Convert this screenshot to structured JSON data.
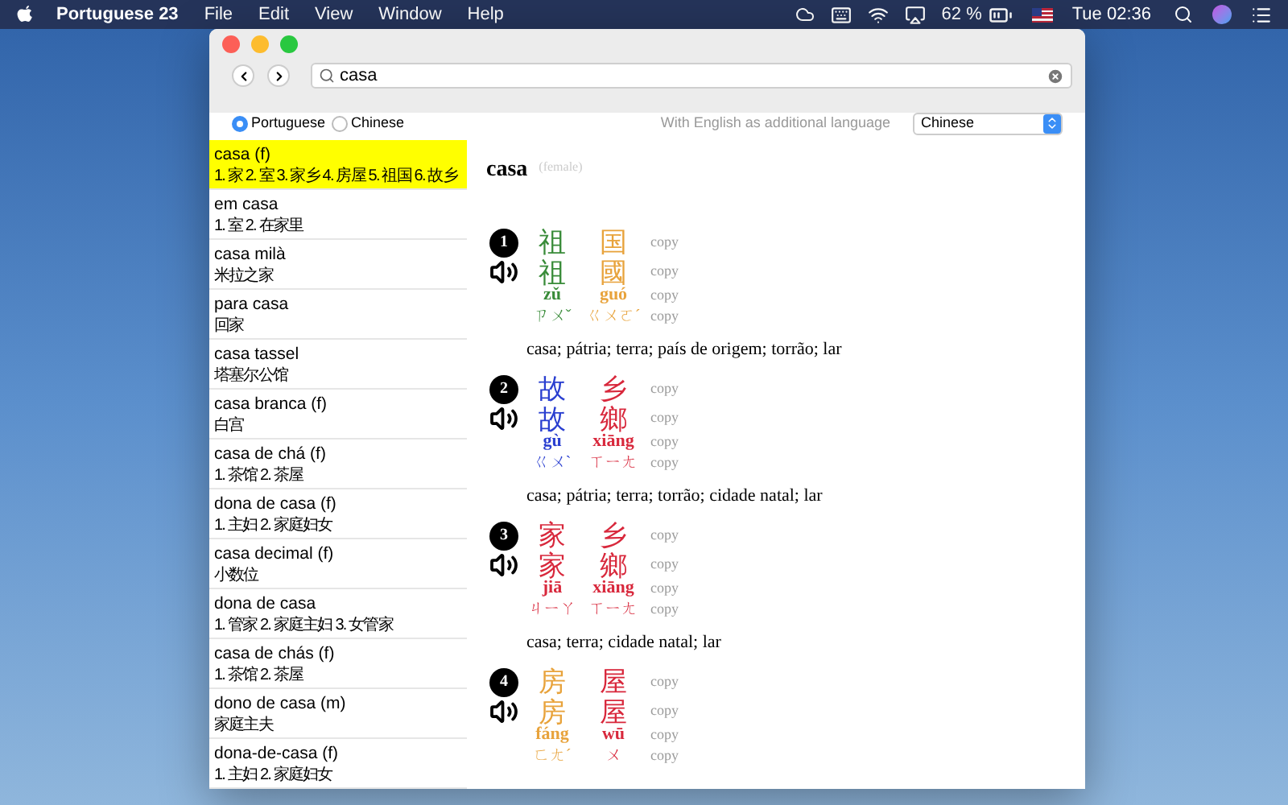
{
  "menu_bar": {
    "app_name": "Portuguese 23",
    "menus": [
      "File",
      "Edit",
      "View",
      "Window",
      "Help"
    ],
    "battery_text": "62 %",
    "clock": "Tue 02:36"
  },
  "toolbar": {
    "search_value": "casa"
  },
  "source_languages": [
    {
      "label": "Portuguese",
      "selected": true
    },
    {
      "label": "Chinese",
      "selected": false
    }
  ],
  "additional_language": {
    "label": "With English as additional language",
    "value": "Chinese"
  },
  "results": [
    {
      "term": "casa (f)",
      "translation": "1. 家 2. 室 3. 家乡 4. 房屋 5. 祖国 6. 故乡",
      "selected": true
    },
    {
      "term": "em casa",
      "translation": "1. 室 2. 在家里",
      "selected": false
    },
    {
      "term": "casa milà",
      "translation": "米拉之家",
      "selected": false
    },
    {
      "term": "para casa",
      "translation": "回家",
      "selected": false
    },
    {
      "term": "casa tassel",
      "translation": "塔塞尔公馆",
      "selected": false
    },
    {
      "term": "casa branca (f)",
      "translation": "白宫",
      "selected": false
    },
    {
      "term": "casa de chá (f)",
      "translation": "1. 茶馆 2. 茶屋",
      "selected": false
    },
    {
      "term": "dona de casa (f)",
      "translation": "1. 主妇 2. 家庭妇女",
      "selected": false
    },
    {
      "term": "casa decimal (f)",
      "translation": "小数位",
      "selected": false
    },
    {
      "term": "dona de casa",
      "translation": "1. 管家 2. 家庭主妇 3. 女管家",
      "selected": false
    },
    {
      "term": "casa de chás (f)",
      "translation": "1. 茶馆 2. 茶屋",
      "selected": false
    },
    {
      "term": "dono de casa (m)",
      "translation": "家庭主夫",
      "selected": false
    },
    {
      "term": "dona-de-casa (f)",
      "translation": "1. 主妇 2. 家庭妇女",
      "selected": false
    }
  ],
  "entry": {
    "headword": "casa",
    "gender": "(female)",
    "senses": [
      {
        "number": "1",
        "copy_labels": [
          "copy",
          "copy",
          "copy",
          "copy"
        ],
        "chars": [
          {
            "simplified": "祖",
            "traditional": "祖",
            "pinyin": "zǔ",
            "zhuyin": "ㄗㄨˇ",
            "color": "#3a8c3a"
          },
          {
            "simplified": "国",
            "traditional": "國",
            "pinyin": "guó",
            "zhuyin": "ㄍㄨㄛˊ",
            "color": "#e8a33c"
          }
        ],
        "meaning": "casa; pátria; terra; país de origem; torrão; lar"
      },
      {
        "number": "2",
        "copy_labels": [
          "copy",
          "copy",
          "copy",
          "copy"
        ],
        "chars": [
          {
            "simplified": "故",
            "traditional": "故",
            "pinyin": "gù",
            "zhuyin": "ㄍㄨˋ",
            "color": "#2a3fd0"
          },
          {
            "simplified": "乡",
            "traditional": "鄉",
            "pinyin": "xiāng",
            "zhuyin": "ㄒㄧㄤ",
            "color": "#d8283c"
          }
        ],
        "meaning": "casa; pátria; terra; torrão; cidade natal; lar"
      },
      {
        "number": "3",
        "copy_labels": [
          "copy",
          "copy",
          "copy",
          "copy"
        ],
        "chars": [
          {
            "simplified": "家",
            "traditional": "家",
            "pinyin": "jiā",
            "zhuyin": "ㄐㄧㄚ",
            "color": "#d8283c"
          },
          {
            "simplified": "乡",
            "traditional": "鄉",
            "pinyin": "xiāng",
            "zhuyin": "ㄒㄧㄤ",
            "color": "#d8283c"
          }
        ],
        "meaning": "casa; terra; cidade natal; lar"
      },
      {
        "number": "4",
        "copy_labels": [
          "copy",
          "copy",
          "copy",
          "copy"
        ],
        "chars": [
          {
            "simplified": "房",
            "traditional": "房",
            "pinyin": "fáng",
            "zhuyin": "ㄈㄤˊ",
            "color": "#e8a33c"
          },
          {
            "simplified": "屋",
            "traditional": "屋",
            "pinyin": "wū",
            "zhuyin": "ㄨ",
            "color": "#d8283c"
          }
        ]
      }
    ]
  }
}
